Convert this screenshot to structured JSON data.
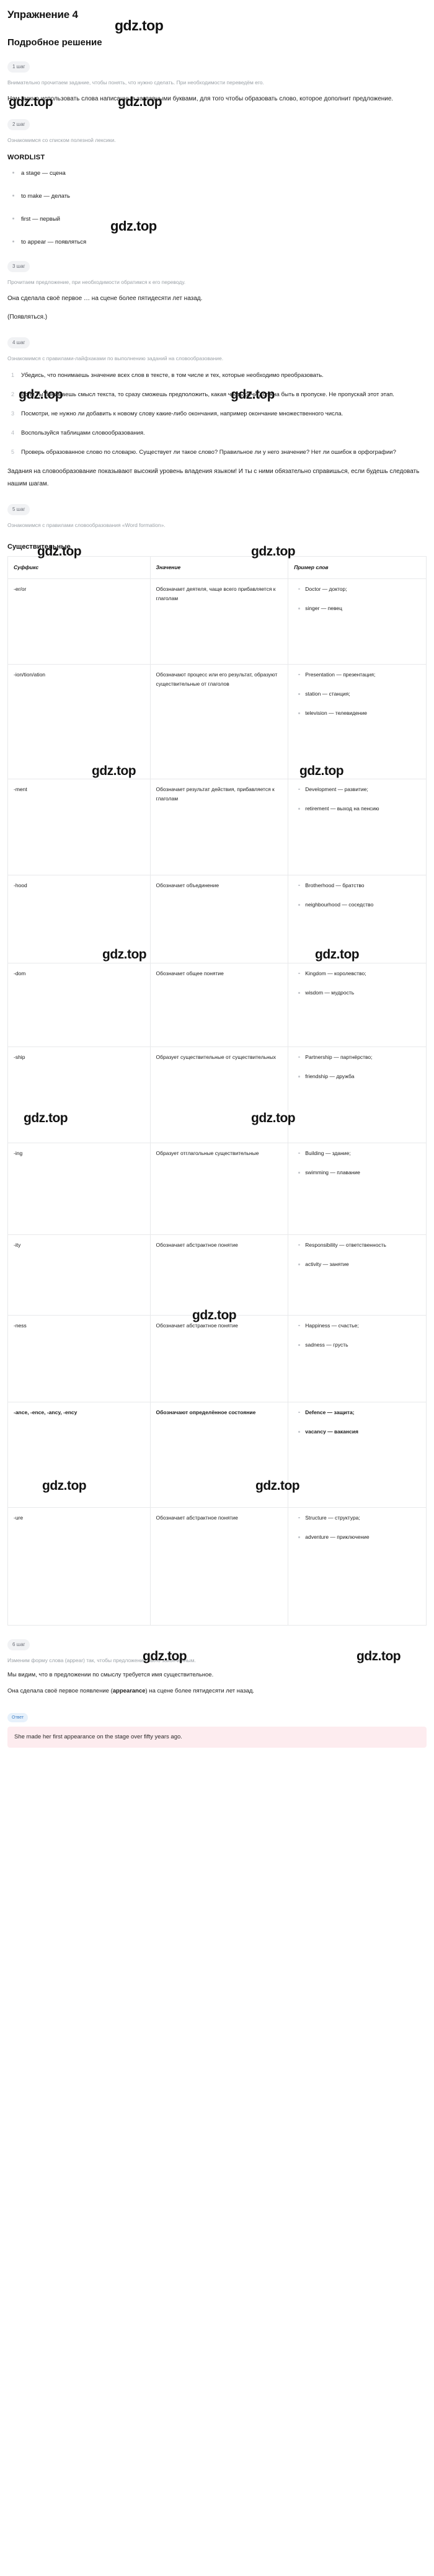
{
  "exercise": {
    "title": "Упражнение 4",
    "solution_heading": "Подробное решение"
  },
  "watermark": {
    "text": "gdz.top"
  },
  "steps": [
    {
      "chip": "1 шаг",
      "muted": "Внимательно прочитаем задание, чтобы понять, что нужно сделать. При необходимости переведём его.",
      "para": "Нам нужно использовать слова написанные заглавными буквами, для того чтобы образовать слово, которое дополнит предложение."
    },
    {
      "chip": "2 шаг",
      "muted": "Ознакомимся со списком полезной лексики.",
      "wordlist_title": "WORDLIST",
      "wordlist": [
        "a stage — сцена",
        "to make — делать",
        "first — первый",
        "to appear — появляться"
      ]
    },
    {
      "chip": "3 шаг",
      "muted": "Прочитаем предложение, при необходимости обратимся к его переводу.",
      "sentence": "Она сделала своё первое … на сцене более пятидесяти лет назад.",
      "hint": "(Появляться.)"
    },
    {
      "chip": "4 шаг",
      "muted": "Ознакомимся с правилами-лайфхаками по выполнению заданий на словообразование.",
      "tips": [
        "Убедись, что понимаешь значение всех слов в тексте, в том числе и тех, которые необходимо преобразовать.",
        "Если ты понимаешь смысл текста, то сразу сможешь предположить, какая часть речи должна быть в пропуске. Не пропускай этот этап.",
        "Посмотри, не нужно ли добавить к новому слову какие-либо окончания, например окончание множественного числа.",
        "Воспользуйся таблицами словообразования.",
        "Проверь образованное слово по словарю. Существует ли такое слово? Правильное ли у него значение? Нет ли ошибок в орфографии?"
      ],
      "closing": "Задания на словообразование показывают высокий уровень владения языком! И ты с ними обязательно справишься, если будешь следовать нашим шагам."
    },
    {
      "chip": "5 шаг",
      "muted": "Ознакомимся с правилами словообразования «Word formation».",
      "table_title": "Существительные"
    },
    {
      "chip": "6 шаг",
      "muted": "Изменим форму слова (appear) так, чтобы предложение было законченным.",
      "para1": "Мы видим, что в предложении по смыслу требуется имя существительное.",
      "para2_prefix": "Она сделала своё первое появление (",
      "para2_bold": "appearance",
      "para2_suffix": ") на сцене более пятидесяти лет назад."
    }
  ],
  "table": {
    "headers": [
      "Суффикс",
      "Значение",
      "Пример слов"
    ],
    "rows": [
      {
        "suffix": "-er/or",
        "meaning": "Обозначает деятеля, чаще всего прибавляется к глаголам",
        "examples": [
          "Doctor — доктор;",
          "singer — певец"
        ],
        "bold": false
      },
      {
        "suffix": "-ion/tion/ation",
        "meaning": "Обозначают процесс или его результат, образуют существительные от глаголов",
        "examples": [
          "Presentation — презентация;",
          "station — станция;",
          "television — телевидение"
        ],
        "bold": false
      },
      {
        "suffix": "-ment",
        "meaning": "Обозначает результат действия, прибавляется к глаголам",
        "examples": [
          "Development — развитие;",
          "retirement — выход на пенсию"
        ],
        "bold": false
      },
      {
        "suffix": "-hood",
        "meaning": "Обозначает объединение",
        "examples": [
          "Brotherhood — братство",
          "neighbourhood — соседство"
        ],
        "bold": false
      },
      {
        "suffix": "-dom",
        "meaning": "Обозначает общее понятие",
        "examples": [
          "Kingdom — королевство;",
          "wisdom — мудрость"
        ],
        "bold": false
      },
      {
        "suffix": "-ship",
        "meaning": "Образует существительные от существительных",
        "examples": [
          "Partnership — партнёрство;",
          "friendship — дружба"
        ],
        "bold": false
      },
      {
        "suffix": "-ing",
        "meaning": "Образует отглагольные существительные",
        "examples": [
          "Building — здание;",
          "swimming — плавание"
        ],
        "bold": false
      },
      {
        "suffix": "-ity",
        "meaning": "Обозначает абстрактное понятие",
        "examples": [
          "Responsibility — ответственность",
          "activity — занятие"
        ],
        "bold": false
      },
      {
        "suffix": "-ness",
        "meaning": "Обозначает абстрактное понятие",
        "examples": [
          "Happiness — счастье;",
          "sadness — грусть"
        ],
        "bold": false
      },
      {
        "suffix": "-ance, -ence, -ancy, -ency",
        "meaning": "Обозначают определённое состояние",
        "examples": [
          "Defence — защита;",
          "vacancy — вакансия"
        ],
        "bold": true
      },
      {
        "suffix": "-ure",
        "meaning": "Обозначает абстрактное понятие",
        "examples": [
          "Structure — структура;",
          "adventure — приключение"
        ],
        "bold": false
      }
    ]
  },
  "answer": {
    "chip": "Ответ",
    "text": "She made her first appearance on the stage over fifty years ago."
  }
}
